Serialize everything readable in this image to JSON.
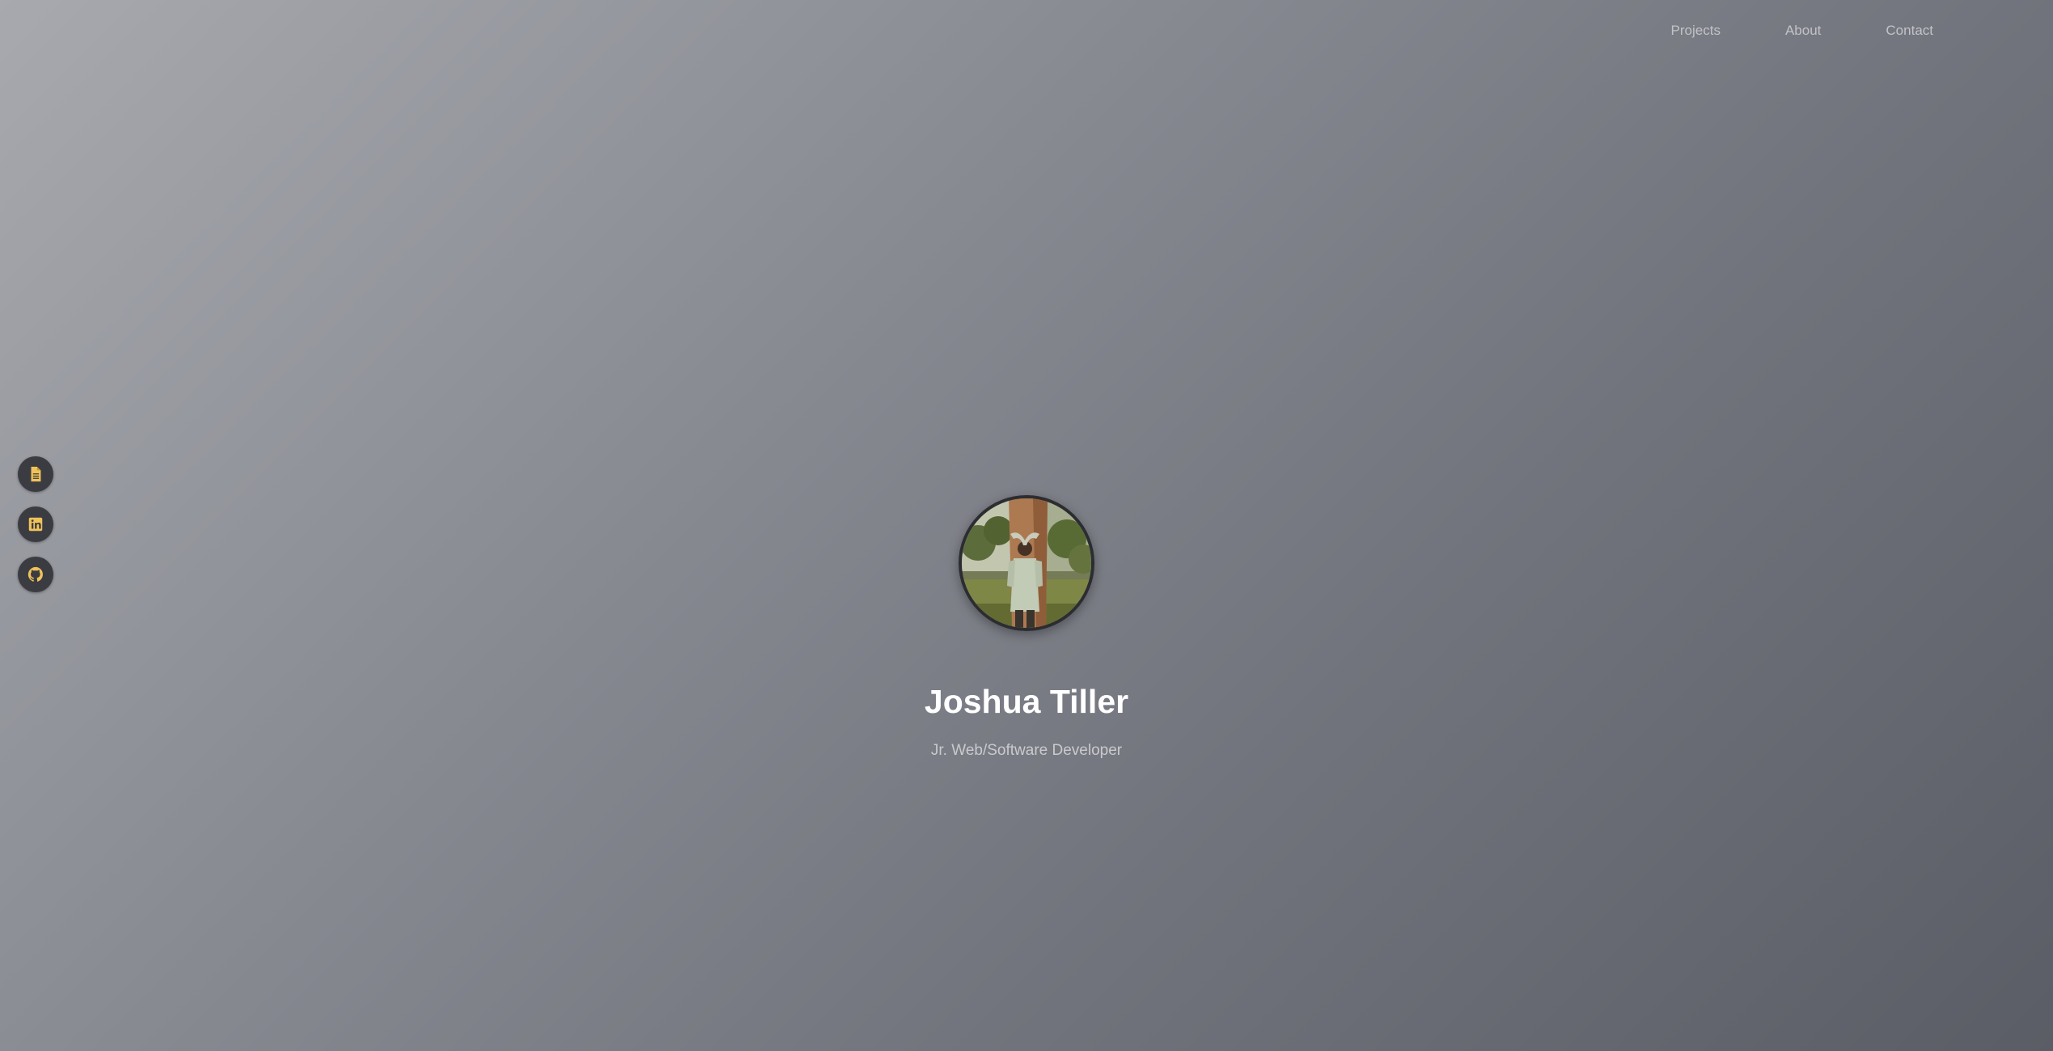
{
  "nav": {
    "items": [
      {
        "label": "Projects"
      },
      {
        "label": "About"
      },
      {
        "label": "Contact"
      }
    ]
  },
  "side_links": [
    {
      "icon": "document-icon"
    },
    {
      "icon": "linkedin-icon"
    },
    {
      "icon": "github-icon"
    }
  ],
  "hero": {
    "name": "Joshua Tiller",
    "subtitle": "Jr. Web/Software Developer"
  },
  "colors": {
    "accent": "#f0c35a",
    "icon_bg": "#3b3c42",
    "nav_text": "#c2c3c6"
  }
}
